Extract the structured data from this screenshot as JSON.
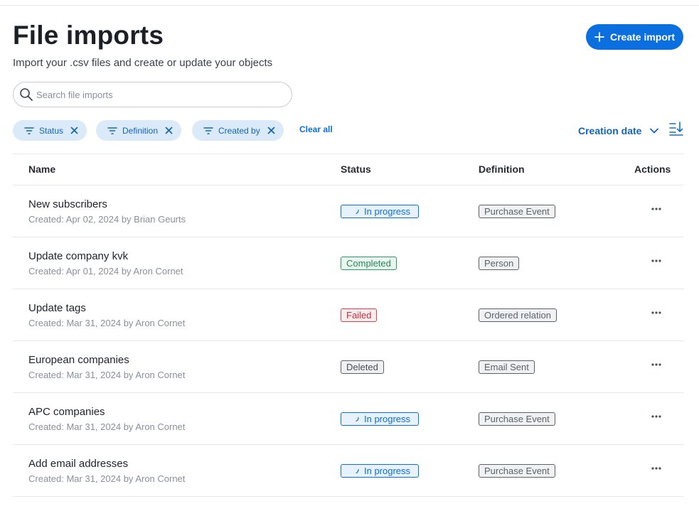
{
  "header": {
    "title": "File imports",
    "subtitle": "Import your .csv files and create or update your objects",
    "create_label": "Create import"
  },
  "search": {
    "placeholder": "Search file imports",
    "value": ""
  },
  "filters": {
    "chips": [
      {
        "label": "Status"
      },
      {
        "label": "Definition"
      },
      {
        "label": "Created by"
      }
    ],
    "clear_all": "Clear all"
  },
  "sort": {
    "label": "Creation date",
    "direction": "descending"
  },
  "table": {
    "columns": {
      "name": "Name",
      "status": "Status",
      "definition": "Definition",
      "actions": "Actions"
    },
    "rows": [
      {
        "name": "New subscribers",
        "meta": "Created: Apr 02, 2024 by Brian Geurts",
        "status": "In progress",
        "definition": "Purchase Event"
      },
      {
        "name": "Update company kvk",
        "meta": "Created: Apr 01, 2024 by Aron Cornet",
        "status": "Completed",
        "definition": "Person"
      },
      {
        "name": "Update tags",
        "meta": "Created: Mar 31, 2024 by Aron Cornet",
        "status": "Failed",
        "definition": "Ordered relation"
      },
      {
        "name": "European companies",
        "meta": "Created: Mar 31, 2024 by Aron Cornet",
        "status": "Deleted",
        "definition": "Email Sent"
      },
      {
        "name": "APC companies",
        "meta": "Created: Mar 31, 2024 by Aron Cornet",
        "status": "In progress",
        "definition": "Purchase Event"
      },
      {
        "name": "Add email addresses",
        "meta": "Created: Mar 31, 2024 by Aron Cornet",
        "status": "In progress",
        "definition": "Purchase Event"
      }
    ]
  },
  "colors": {
    "accent": "#0b6fe0",
    "chip_bg": "#dbeaf8",
    "in_progress": "#0b6fe0",
    "completed": "#2a9a63",
    "failed": "#d9434f",
    "deleted": "#5b626a"
  },
  "icons": [
    "plus-icon",
    "search-icon",
    "filter-icon",
    "close-icon",
    "chevron-down-icon",
    "sort-descending-icon",
    "spinner-icon",
    "more-horizontal-icon"
  ]
}
